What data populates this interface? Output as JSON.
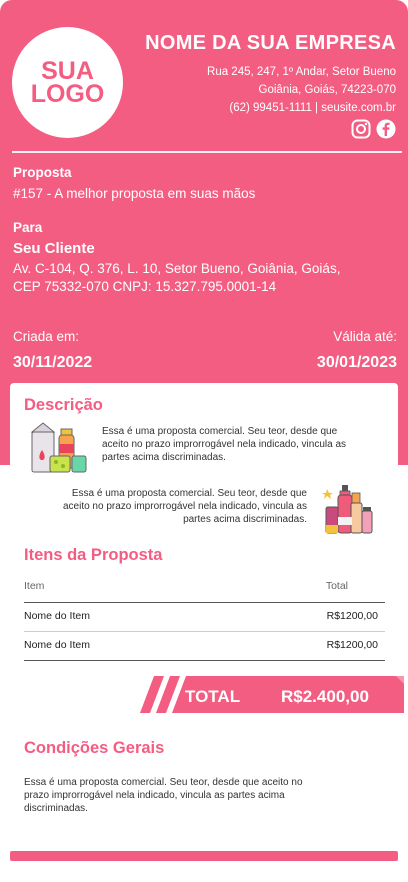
{
  "colors": {
    "accent": "#f45d82",
    "background": "#ffffff",
    "text": "#333333"
  },
  "logo": {
    "line1": "SUA",
    "line2": "LOGO"
  },
  "company": {
    "name": "NOME DA SUA EMPRESA",
    "address_line1": "Rua 245, 247, 1º Andar, Setor Bueno",
    "address_line2": "Goiânia, Goiás, 74223-070",
    "contact": "(62) 99451-1111 | seusite.com.br",
    "social_icons": [
      "instagram-icon",
      "facebook-icon"
    ]
  },
  "proposal": {
    "label": "Proposta",
    "value": "#157 - A melhor proposta em suas mãos"
  },
  "client": {
    "label": "Para",
    "name": "Seu Cliente",
    "address_line1": "Av. C-104, Q. 376, L. 10, Setor Bueno, Goiânia, Goiás,",
    "address_line2": "CEP 75332-070 CNPJ: 15.327.795.0001-14"
  },
  "dates": {
    "created_label": "Criada em:",
    "created_value": "30/11/2022",
    "valid_label": "Válida até:",
    "valid_value": "30/01/2023"
  },
  "description": {
    "title": "Descrição",
    "para1_line1": "Essa é uma proposta comercial. Seu teor, desde que",
    "para1_line2": "aceito no prazo improrrogável nela indicado, vincula as",
    "para1_line3": "partes acima discriminadas.",
    "para2_line1": "Essa é uma proposta comercial. Seu teor, desde que",
    "para2_line2": "aceito no prazo improrrogável nela indicado, vincula as",
    "para2_line3": "partes acima discriminadas.",
    "images": [
      "grocery-products-illustration",
      "cosmetics-products-illustration"
    ]
  },
  "items": {
    "title": "Itens da Proposta",
    "col_item": "Item",
    "col_total": "Total",
    "rows": [
      {
        "name": "Nome do Item",
        "total": "R$1200,00"
      },
      {
        "name": "Nome do Item",
        "total": "R$1200,00"
      }
    ]
  },
  "total": {
    "label": "TOTAL",
    "value": "R$2.400,00"
  },
  "conditions": {
    "title": "Condições Gerais",
    "line1": "Essa é uma proposta comercial. Seu teor, desde que aceito no",
    "line2": "prazo improrrogável nela indicado, vincula as partes acima",
    "line3": "discriminadas."
  }
}
